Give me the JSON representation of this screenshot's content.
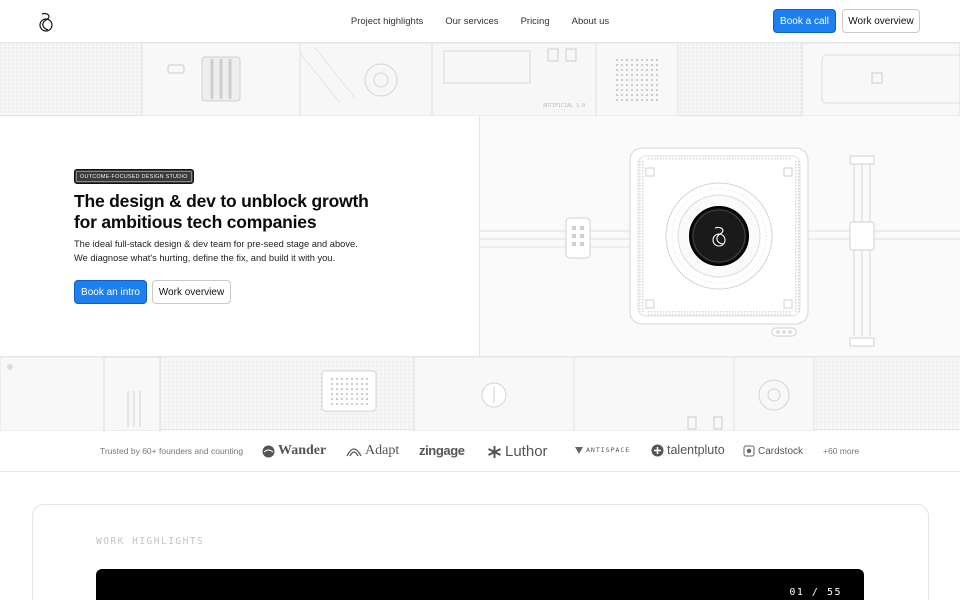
{
  "nav": {
    "links": [
      "Project highlights",
      "Our services",
      "Pricing",
      "About us"
    ],
    "cta_primary": "Book a call",
    "cta_secondary": "Work overview"
  },
  "hero": {
    "badge": "OUTCOME-FOCUSED DESIGN STUDIO",
    "title": "The design & dev to unblock growth for ambitious tech companies",
    "subtitle_line1": "The ideal full-stack design & dev team for pre-seed stage and above.",
    "subtitle_line2": "We diagnose what's hurting, define the fix, and build it with you.",
    "cta_primary": "Book an intro",
    "cta_secondary": "Work overview",
    "tile_caption": "ARTIFICIAL 1.0"
  },
  "trust": {
    "label": "Trusted by 60+ founders and counting",
    "logos": [
      "Wander",
      "Adapt",
      "zingage",
      "Luthor",
      "ANTISPACE",
      "talentpluto",
      "Cardstock"
    ],
    "more": "+60 more"
  },
  "work": {
    "label": "WORK HIGHLIGHTS",
    "counter": "01 / 55"
  },
  "colors": {
    "accent": "#1d7ff0",
    "border": "#e6e6e6",
    "panel": "#000000"
  }
}
